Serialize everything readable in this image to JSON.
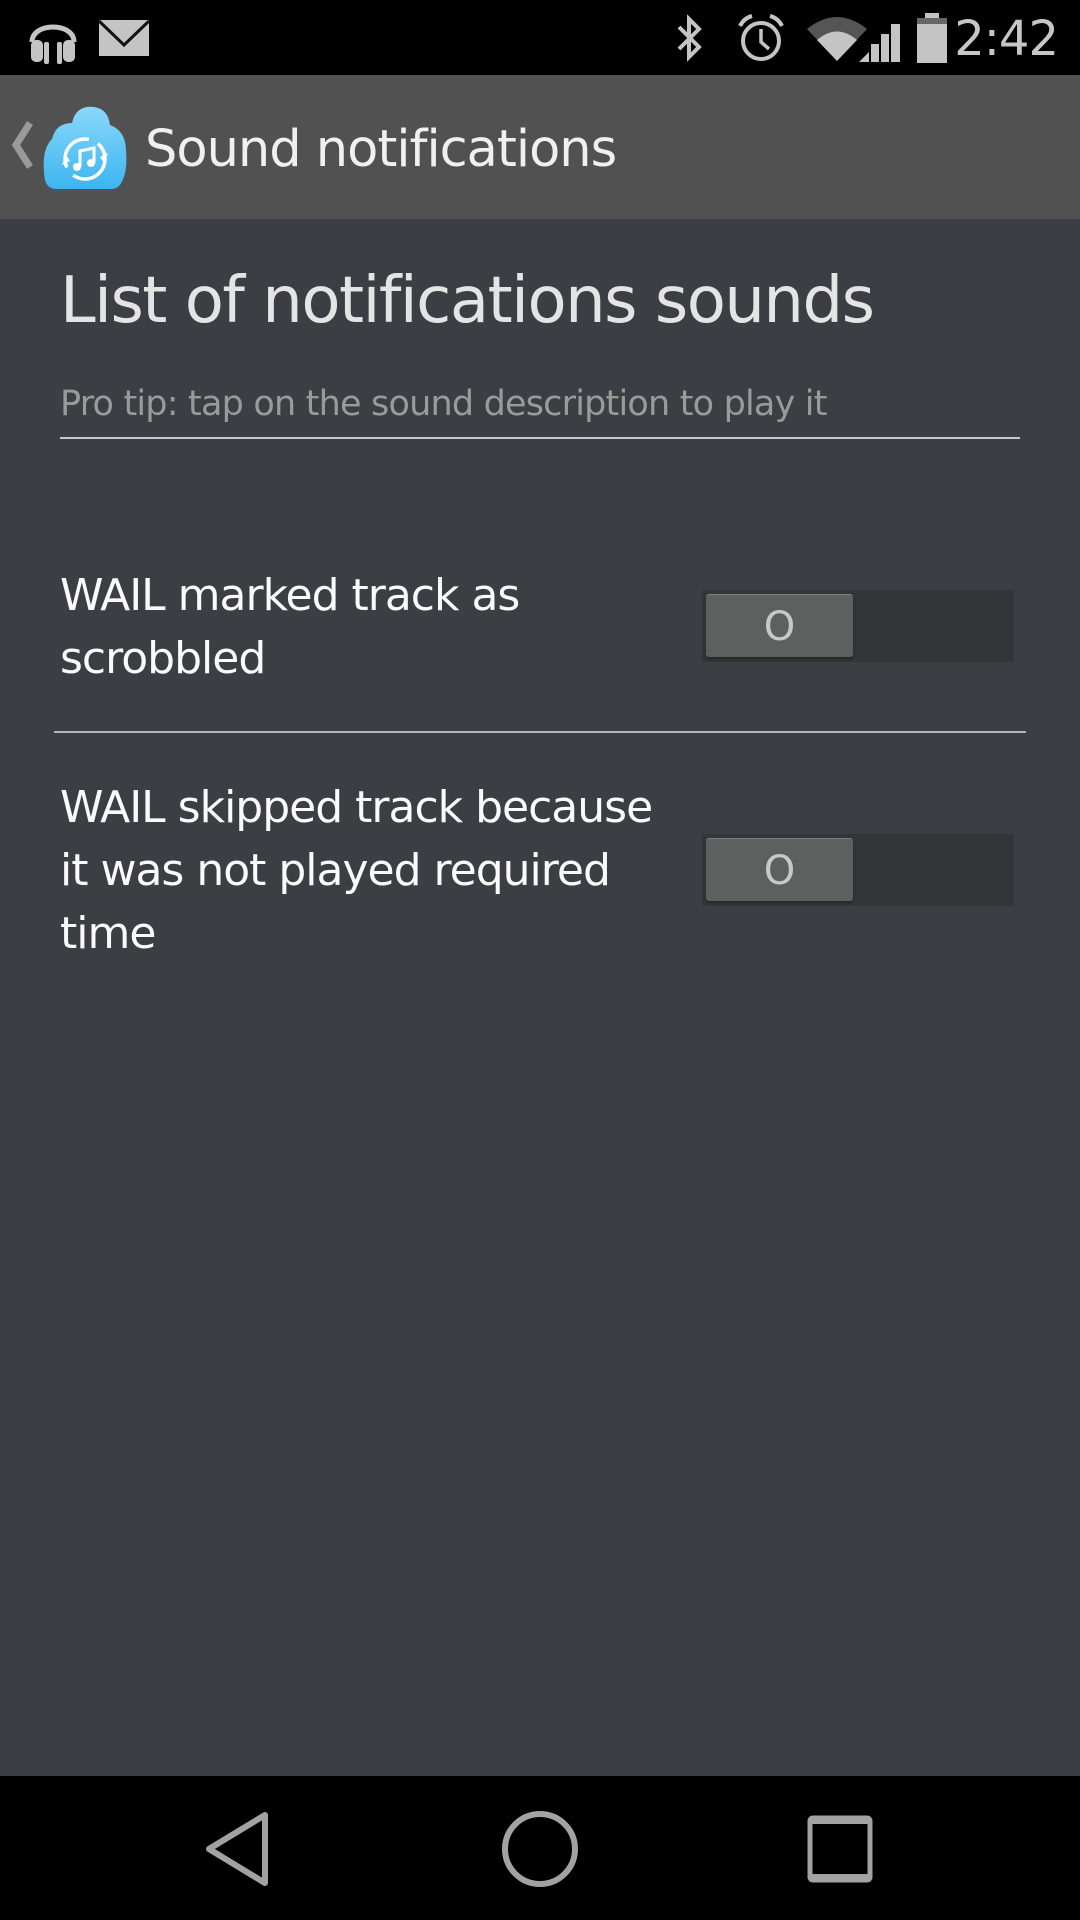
{
  "status_bar": {
    "left_icons": [
      "headphones-icon",
      "mail-icon"
    ],
    "right_icons": [
      "bluetooth-icon",
      "alarm-icon",
      "wifi-icon",
      "signal-icon",
      "battery-icon"
    ],
    "time": "2:42"
  },
  "action_bar": {
    "up_icon": "chevron-left-icon",
    "app_icon": "cloud-music-sync-icon",
    "title": "Sound notifications"
  },
  "content": {
    "heading": "List of notifications sounds",
    "tip": "Pro tip: tap on the sound description to play it",
    "items": [
      {
        "label": "WAIL marked track as scrobbled",
        "toggle_state": "off",
        "toggle_text": "O"
      },
      {
        "label": "WAIL skipped track because it was not played required time",
        "toggle_state": "off",
        "toggle_text": "O"
      }
    ]
  },
  "nav_bar": {
    "buttons": [
      "back-icon",
      "home-icon",
      "recents-icon"
    ]
  },
  "colors": {
    "background": "#3b3e42",
    "action_bar": "#515151",
    "app_icon_blue": "#4fc0f5"
  }
}
